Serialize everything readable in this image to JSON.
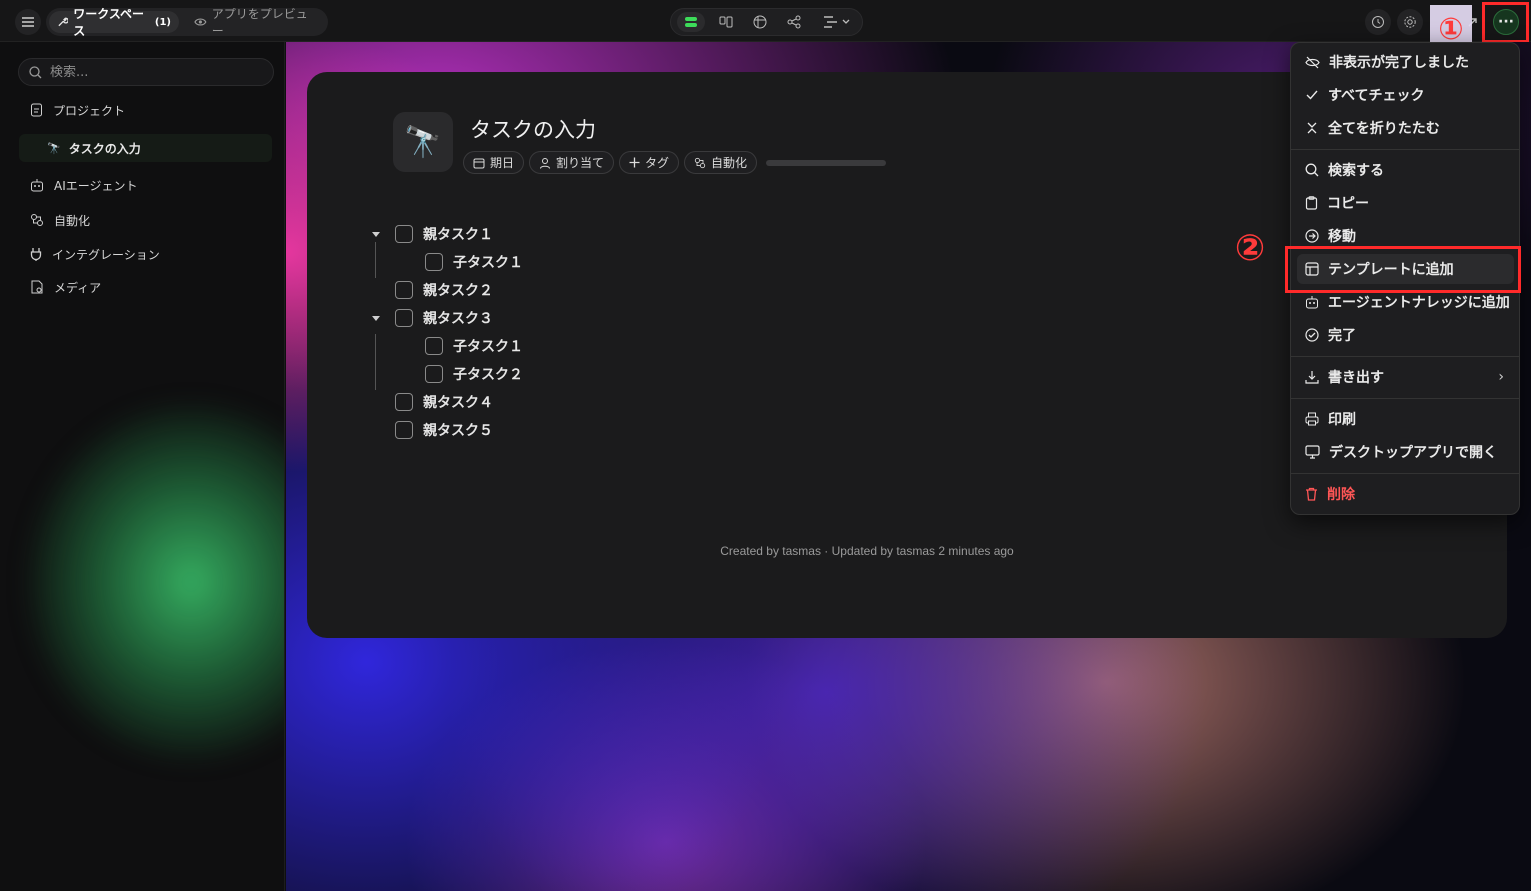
{
  "topbar": {
    "workspace_label": "ワークスペース",
    "workspace_count": "(1)",
    "preview_label": "アプリをプレビュー"
  },
  "sidebar": {
    "search_placeholder": "検索...",
    "items": [
      {
        "label": "プロジェクト",
        "icon": "document-icon"
      },
      {
        "label": "タスクの入力",
        "icon": "telescope-icon"
      },
      {
        "label": "AIエージェント",
        "icon": "robot-icon"
      },
      {
        "label": "自動化",
        "icon": "automation-icon"
      },
      {
        "label": "インテグレーション",
        "icon": "plug-icon"
      },
      {
        "label": "メディア",
        "icon": "media-icon"
      }
    ]
  },
  "document": {
    "title": "タスクの入力",
    "chips": [
      "期日",
      "割り当て",
      "タグ",
      "自動化"
    ],
    "tasks": [
      {
        "label": "親タスク１"
      },
      {
        "label": "子タスク１"
      },
      {
        "label": "親タスク２"
      },
      {
        "label": "親タスク３"
      },
      {
        "label": "子タスク１"
      },
      {
        "label": "子タスク２"
      },
      {
        "label": "親タスク４"
      },
      {
        "label": "親タスク５"
      }
    ],
    "footer": "Created by tasmas · Updated by tasmas 2 minutes ago"
  },
  "menu": {
    "items": [
      {
        "label": "非表示が完了しました",
        "icon": "eye-off-icon"
      },
      {
        "label": "すべてチェック",
        "icon": "check-icon"
      },
      {
        "label": "全てを折りたたむ",
        "icon": "collapse-icon"
      },
      {
        "label": "検索する",
        "icon": "search-icon"
      },
      {
        "label": "コピー",
        "icon": "clipboard-icon"
      },
      {
        "label": "移動",
        "icon": "move-icon"
      },
      {
        "label": "テンプレートに追加",
        "icon": "template-icon"
      },
      {
        "label": "エージェントナレッジに追加",
        "icon": "robot-icon"
      },
      {
        "label": "完了",
        "icon": "check-circle-icon"
      },
      {
        "label": "書き出す",
        "icon": "download-icon"
      },
      {
        "label": "印刷",
        "icon": "printer-icon"
      },
      {
        "label": "デスクトップアプリで開く",
        "icon": "monitor-icon"
      },
      {
        "label": "削除",
        "icon": "trash-icon"
      }
    ]
  },
  "annotations": {
    "marker_1": "①",
    "marker_2": "②"
  },
  "colors": {
    "highlight_red": "#ff2a2a",
    "accent_green": "#3ddc5a",
    "danger": "#ff5656"
  }
}
